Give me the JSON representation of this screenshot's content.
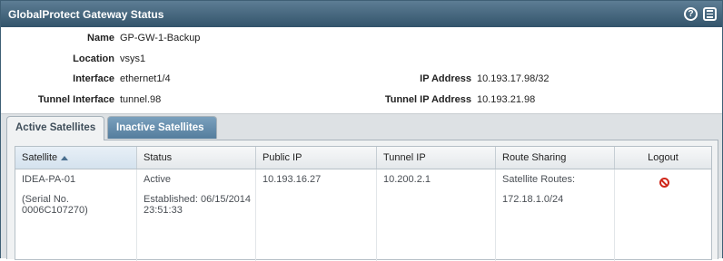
{
  "window": {
    "title": "GlobalProtect Gateway Status",
    "help_icon": "help-icon",
    "menu_icon": "list-icon"
  },
  "info": {
    "name_label": "Name",
    "name_value": "GP-GW-1-Backup",
    "location_label": "Location",
    "location_value": "vsys1",
    "interface_label": "Interface",
    "interface_value": "ethernet1/4",
    "tunnel_interface_label": "Tunnel Interface",
    "tunnel_interface_value": "tunnel.98",
    "ip_address_label": "IP Address",
    "ip_address_value": "10.193.17.98/32",
    "tunnel_ip_label": "Tunnel IP Address",
    "tunnel_ip_value": "10.193.21.98"
  },
  "tabs": {
    "active": "Active Satellites",
    "inactive": "Inactive Satellites"
  },
  "table": {
    "columns": [
      "Satellite",
      "Status",
      "Public IP",
      "Tunnel IP",
      "Route Sharing",
      "Logout"
    ],
    "sorted_column": "Satellite",
    "sort_direction": "ascending",
    "rows": [
      {
        "satellite": "IDEA-PA-01",
        "serial_line1": "(Serial No.",
        "serial_line2": "0006C107270)",
        "status": "Active",
        "established_line1": "Established: 06/15/2014",
        "established_line2": "23:51:33",
        "public_ip": "10.193.16.27",
        "tunnel_ip": "10.200.2.1",
        "route_sharing_label": "Satellite Routes:",
        "route_sharing_value": "172.18.1.0/24",
        "logout_icon": "logout-prohibit-icon"
      }
    ]
  },
  "colors": {
    "titlebar": "#3f5f75",
    "inactive_tab": "#6890b0",
    "logout_icon": "#d0271a"
  }
}
